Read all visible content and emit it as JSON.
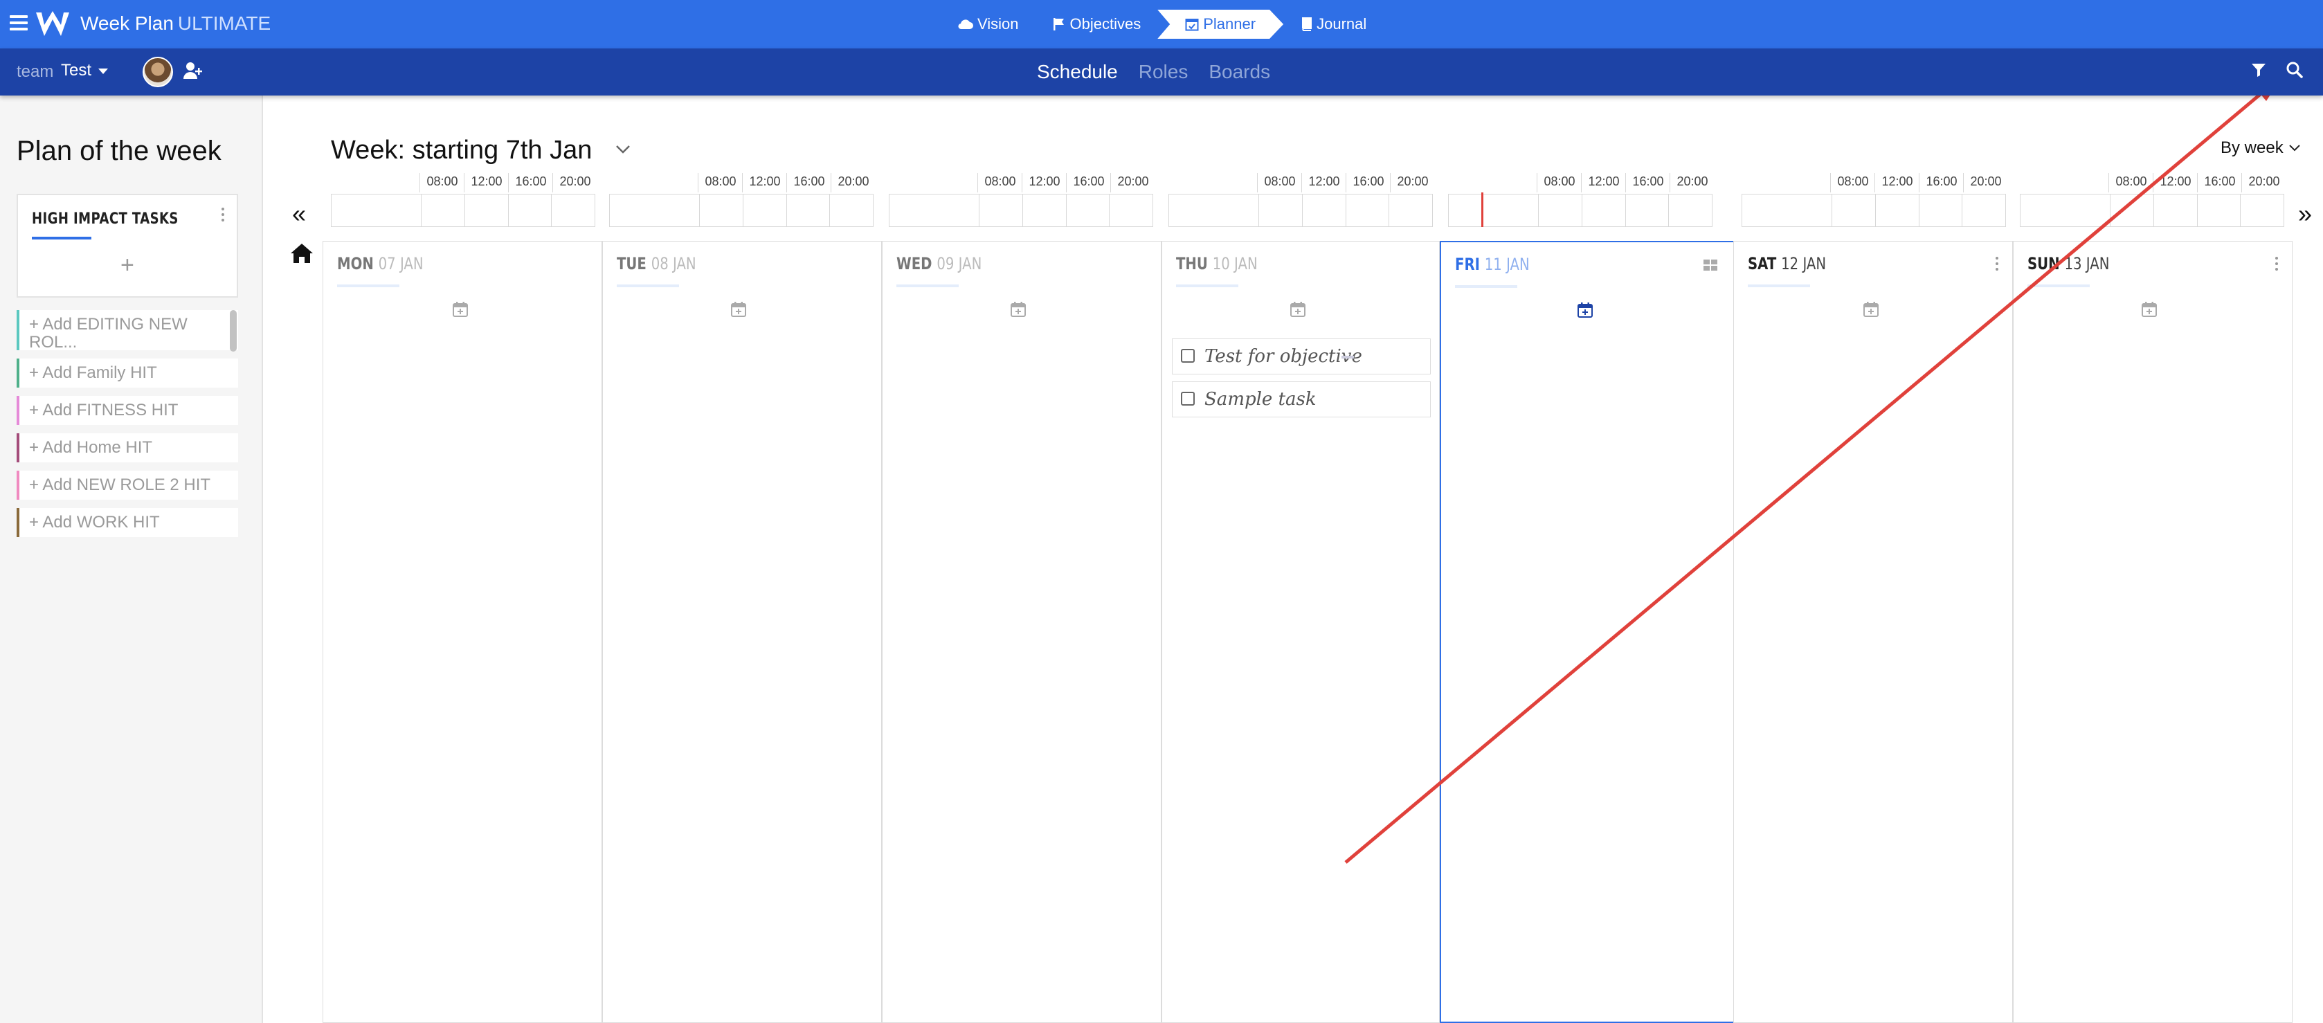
{
  "app": {
    "title": "Week Plan",
    "edition": "ULTIMATE"
  },
  "nav": [
    {
      "label": "Vision",
      "icon": "cloud-icon"
    },
    {
      "label": "Objectives",
      "icon": "flag-icon"
    },
    {
      "label": "Planner",
      "icon": "calendar-icon",
      "active": true
    },
    {
      "label": "Journal",
      "icon": "book-icon"
    }
  ],
  "team": {
    "label": "team",
    "name": "Test"
  },
  "subtabs": [
    {
      "label": "Schedule",
      "active": true
    },
    {
      "label": "Roles"
    },
    {
      "label": "Boards"
    }
  ],
  "sidebar": {
    "title": "Plan of the week",
    "hit_title": "HIGH IMPACT TASKS",
    "hit_add": "+",
    "items": [
      {
        "label": "+ Add EDITING NEW ROL...",
        "color": "#5bc8c0"
      },
      {
        "label": "+ Add Family HIT",
        "color": "#4fb08a"
      },
      {
        "label": "+ Add FITNESS HIT",
        "color": "#e58ad8"
      },
      {
        "label": "+ Add Home HIT",
        "color": "#a44d7a"
      },
      {
        "label": "+ Add NEW ROLE 2 HIT",
        "color": "#f08ac0"
      },
      {
        "label": "+ Add WORK HIT",
        "color": "#8a6a3a"
      }
    ]
  },
  "week": {
    "title": "Week: starting 7th Jan",
    "view": "By week",
    "prev": "«",
    "next": "»"
  },
  "timeline": {
    "hours": [
      "08:00",
      "12:00",
      "16:00",
      "20:00"
    ]
  },
  "days": [
    {
      "name": "MON",
      "date": "07 JAN",
      "tasks": []
    },
    {
      "name": "TUE",
      "date": "08 JAN",
      "tasks": []
    },
    {
      "name": "WED",
      "date": "09 JAN",
      "tasks": []
    },
    {
      "name": "THU",
      "date": "10 JAN",
      "tasks": [
        "Test for objective",
        "Sample task"
      ]
    },
    {
      "name": "FRI",
      "date": "11 JAN",
      "tasks": [],
      "today": true
    },
    {
      "name": "SAT",
      "date": "12 JAN",
      "tasks": []
    },
    {
      "name": "SUN",
      "date": "13 JAN",
      "tasks": []
    }
  ],
  "colors": {
    "primary": "#2f6fe6",
    "subbar": "#1d43a6",
    "annotation_arrow": "#e0413b",
    "now_line": "#e0413b"
  }
}
